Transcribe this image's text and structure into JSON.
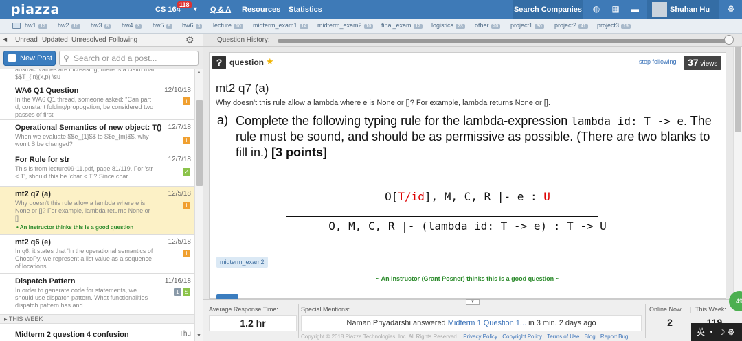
{
  "topbar": {
    "logo": "piazza",
    "course": "CS 164",
    "course_badge": "118",
    "nav": [
      "Q & A",
      "Resources",
      "Statistics"
    ],
    "search_companies": "Search Companies",
    "user_name": "Shuhan Hu"
  },
  "folders": [
    {
      "name": "hw1",
      "count": "12"
    },
    {
      "name": "hw2",
      "count": "10"
    },
    {
      "name": "hw3",
      "count": "8"
    },
    {
      "name": "hw4",
      "count": "3"
    },
    {
      "name": "hw5",
      "count": "9"
    },
    {
      "name": "hw6",
      "count": "3"
    },
    {
      "name": "lecture",
      "count": "10"
    },
    {
      "name": "midterm_exam1",
      "count": "14"
    },
    {
      "name": "midterm_exam2",
      "count": "10"
    },
    {
      "name": "final_exam",
      "count": "12"
    },
    {
      "name": "logistics",
      "count": "23"
    },
    {
      "name": "other",
      "count": "20"
    },
    {
      "name": "project1",
      "count": "30"
    },
    {
      "name": "project2",
      "count": "41"
    },
    {
      "name": "project3",
      "count": "19"
    }
  ],
  "filters": [
    "Unread",
    "Updated",
    "Unresolved",
    "Following"
  ],
  "history_label": "Question History:",
  "new_post": "New Post",
  "search_placeholder": "Search or add a post...",
  "feed": {
    "top_fragment": "abstract values are increasing, there is a claim that $$T_{in}(x,p) \\su",
    "items": [
      {
        "title": "WA6 Q1 Question",
        "date": "12/10/18",
        "body": "In the WA6 Q1 thread, someone asked: \"Can part d, constant folding/propogation, be considered two passes of first",
        "flag": "i"
      },
      {
        "title": "Operational Semantics of new object: T()",
        "date": "12/7/18",
        "body": "When we evaluate $$e_{1}$$ to $$e_{m}$$, why won't S be changed?",
        "flag": "i"
      },
      {
        "title": "For Rule for str",
        "date": "12/7/18",
        "body": "This is from lecture09-11.pdf, page 81/119. For 'str < T', should this be 'char < T'? Since char",
        "flag": "✓"
      },
      {
        "title": "mt2 q7 (a)",
        "date": "12/5/18",
        "body": "Why doesn't this rule allow a lambda where e is None or []? For example, lambda returns None or [].",
        "flag": "i",
        "note": "An instructor thinks this is a good question"
      },
      {
        "title": "mt2 q6 (e)",
        "date": "12/5/18",
        "body": "In q6, it states that 'In the operational semantics of ChocoPy, we represent a list value as a sequence of locations",
        "flag": "i"
      },
      {
        "title": "Dispatch Pattern",
        "date": "11/16/18",
        "body": "In order to generate code for statements, we should use dispatch pattern. What functionalities dispatch pattern has and",
        "flag": "S",
        "count": "1"
      }
    ],
    "week_label": "THIS WEEK",
    "last_item": {
      "title": "Midterm 2 question 4 confusion",
      "date": "Thu"
    }
  },
  "question": {
    "type": "question",
    "stop_following": "stop following",
    "views_count": "37",
    "views_label": "views",
    "title": "mt2 q7 (a)",
    "body": "Why doesn't this rule allow a lambda where e is None or []? For example, lambda returns None or [].",
    "part_label": "a)",
    "part_text_1": "Complete the following typing rule for the lambda-expression ",
    "part_code": "lambda id: T -> e",
    "part_text_2": ". The rule must be sound, and should be as permissive as possible. (There are two blanks to fill in.) ",
    "part_points": "[3 points]",
    "rule_numerator_1": "O[",
    "rule_numerator_red_1": "T/id",
    "rule_numerator_2": "], M, C, R |- e : ",
    "rule_numerator_red_2": "U",
    "rule_denominator": "O, M, C, R |- (lambda id: T -> e) : T -> U",
    "tag": "midterm_exam2",
    "instructor_note": "~ An instructor (Grant Posner) thinks this is a good question ~"
  },
  "footer": {
    "avg_label": "Average Response Time:",
    "avg_value": "1.2 hr",
    "mentions_label": "Special Mentions:",
    "mention_user": "Naman Priyadarshi answered ",
    "mention_link": "Midterm 1 Question 1...",
    "mention_time": " in 3 min. 2 days ago",
    "online_label": "Online Now",
    "online_value": "2",
    "week_label": "This Week:",
    "week_value": "119",
    "copyright": "Copyright © 2018 Piazza Technologies, Inc. All Rights Reserved.",
    "links": [
      "Privacy Policy",
      "Copyright Policy",
      "Terms of Use",
      "Blog",
      "Report Bug!"
    ]
  },
  "ime": "英 ・ ☽ ⚙",
  "badge_circle": "49"
}
